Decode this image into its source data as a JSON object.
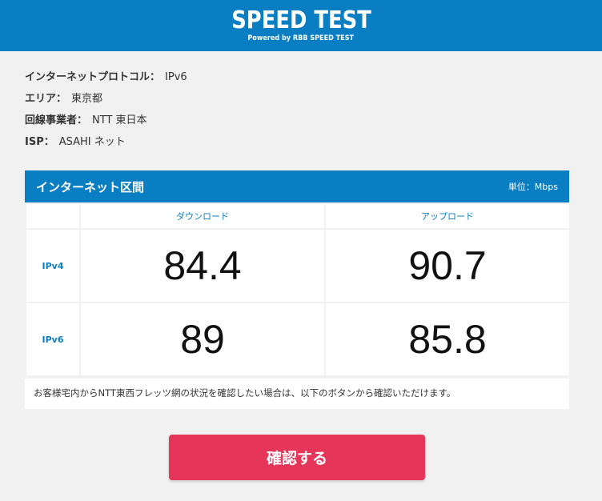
{
  "header": {
    "title": "SPEED TEST",
    "subtitle": "Powered by RBB SPEED TEST"
  },
  "info": {
    "protocol_label": "インターネットプロトコル：",
    "protocol_value": "IPv6",
    "area_label": "エリア：",
    "area_value": "東京都",
    "carrier_label": "回線事業者：",
    "carrier_value": "NTT 東日本",
    "isp_label": "ISP：",
    "isp_value": "ASAHI ネット"
  },
  "panel": {
    "title": "インターネット区間",
    "unit": "単位：Mbps",
    "col_download": "ダウンロード",
    "col_upload": "アップロード",
    "rows": [
      {
        "label": "IPv4",
        "download": "84.4",
        "upload": "90.7"
      },
      {
        "label": "IPv6",
        "download": "89",
        "upload": "85.8"
      }
    ],
    "note": "お客様宅内からNTT東西フレッツ網の状況を確認したい場合は、以下のボタンから確認いただけます。"
  },
  "confirm_button": "確認する",
  "colors": {
    "accent": "#0a7ec2",
    "button": "#e5365a",
    "background": "#f1f1f1"
  }
}
